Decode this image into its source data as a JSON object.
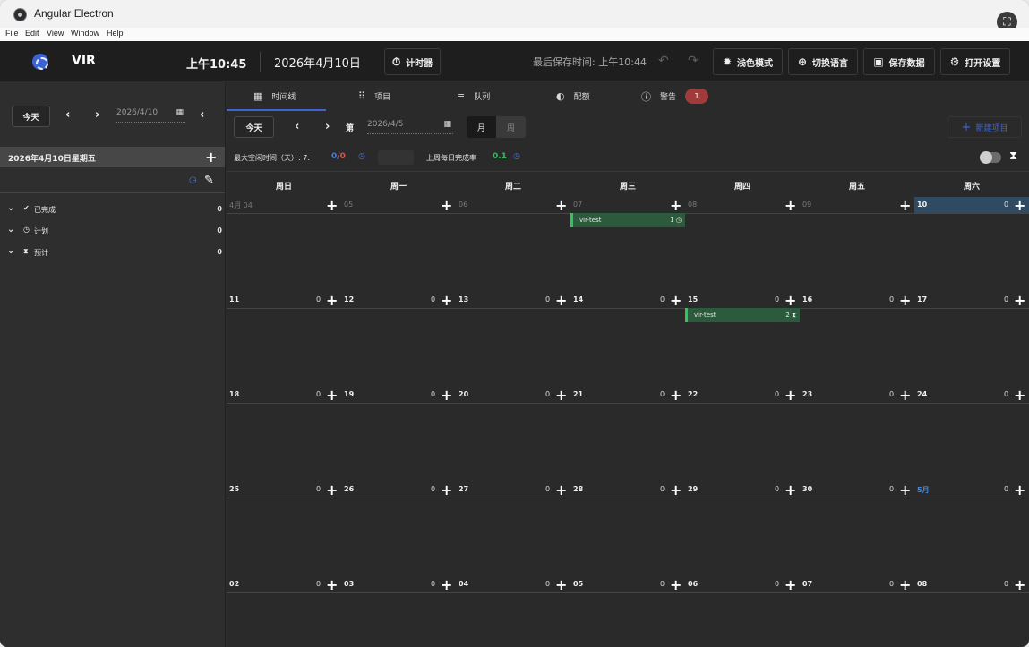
{
  "window": {
    "title": "Angular Electron"
  },
  "menu": [
    "File",
    "Edit",
    "View",
    "Window",
    "Help"
  ],
  "header": {
    "app_name": "VIR",
    "time": "上午10:45",
    "date": "2026年4月10日",
    "timer_label": "计时器",
    "last_saved": "最后保存时间: 上午10:44",
    "light_mode_label": "浅色模式",
    "language_label": "切换语言",
    "save_label": "保存数据",
    "settings_label": "打开设置"
  },
  "sidebar": {
    "today_label": "今天",
    "date_value": "2026/4/10",
    "day_label": "2026年4月10日星期五",
    "groups": [
      {
        "label": "已完成",
        "count": "0",
        "icon": "check-circle-icon"
      },
      {
        "label": "计划",
        "count": "0",
        "icon": "clock-icon"
      },
      {
        "label": "预计",
        "count": "0",
        "icon": "hourglass-icon"
      }
    ]
  },
  "tabs": [
    {
      "label": "时间线",
      "icon": "calendar-icon"
    },
    {
      "label": "项目",
      "icon": "grid-icon"
    },
    {
      "label": "队列",
      "icon": "queue-icon"
    },
    {
      "label": "配额",
      "icon": "pie-icon"
    },
    {
      "label": "警告",
      "icon": "alert-icon",
      "badge": "1"
    }
  ],
  "toolbar": {
    "today_label": "今天",
    "week_prefix": "第",
    "date_value": "2026/4/5",
    "view_month": "月",
    "view_week": "周",
    "new_project_label": "新建项目"
  },
  "stats": {
    "idle_label": "最大空闲时间（天）:  7:",
    "idle_a": "0",
    "idle_sep": "/",
    "idle_b": "0",
    "rate_label": "上周每日完成率",
    "rate_value": "0.1"
  },
  "calendar": {
    "weekdays": [
      "周日",
      "周一",
      "周二",
      "周三",
      "周四",
      "周五",
      "周六"
    ],
    "weeks": [
      [
        {
          "label": "4月 04",
          "count": "",
          "state": "other"
        },
        {
          "label": "05",
          "count": "",
          "state": "other"
        },
        {
          "label": "06",
          "count": "",
          "state": "other"
        },
        {
          "label": "07",
          "count": "",
          "state": "other"
        },
        {
          "label": "08",
          "count": "",
          "state": "other"
        },
        {
          "label": "09",
          "count": "",
          "state": "other"
        },
        {
          "label": "10",
          "count": "0",
          "state": "today"
        }
      ],
      [
        {
          "label": "11",
          "count": "0"
        },
        {
          "label": "12",
          "count": "0"
        },
        {
          "label": "13",
          "count": "0"
        },
        {
          "label": "14",
          "count": "0"
        },
        {
          "label": "15",
          "count": "0"
        },
        {
          "label": "16",
          "count": "0"
        },
        {
          "label": "17",
          "count": "0"
        }
      ],
      [
        {
          "label": "18",
          "count": "0"
        },
        {
          "label": "19",
          "count": "0"
        },
        {
          "label": "20",
          "count": "0"
        },
        {
          "label": "21",
          "count": "0"
        },
        {
          "label": "22",
          "count": "0"
        },
        {
          "label": "23",
          "count": "0"
        },
        {
          "label": "24",
          "count": "0"
        }
      ],
      [
        {
          "label": "25",
          "count": "0"
        },
        {
          "label": "26",
          "count": "0"
        },
        {
          "label": "27",
          "count": "0"
        },
        {
          "label": "28",
          "count": "0"
        },
        {
          "label": "29",
          "count": "0"
        },
        {
          "label": "30",
          "count": "0"
        },
        {
          "label": "5月",
          "count": "0",
          "state": "nextm"
        }
      ],
      [
        {
          "label": "02",
          "count": "0"
        },
        {
          "label": "03",
          "count": "0"
        },
        {
          "label": "04",
          "count": "0"
        },
        {
          "label": "05",
          "count": "0"
        },
        {
          "label": "06",
          "count": "0"
        },
        {
          "label": "07",
          "count": "0"
        },
        {
          "label": "08",
          "count": "0"
        }
      ]
    ],
    "events": [
      {
        "name": "vir-test",
        "count": "1",
        "icon": "clock-icon",
        "week": 0,
        "day": 3
      },
      {
        "name": "vir-test",
        "count": "2",
        "icon": "hourglass-icon",
        "week": 1,
        "day": 4
      }
    ]
  }
}
